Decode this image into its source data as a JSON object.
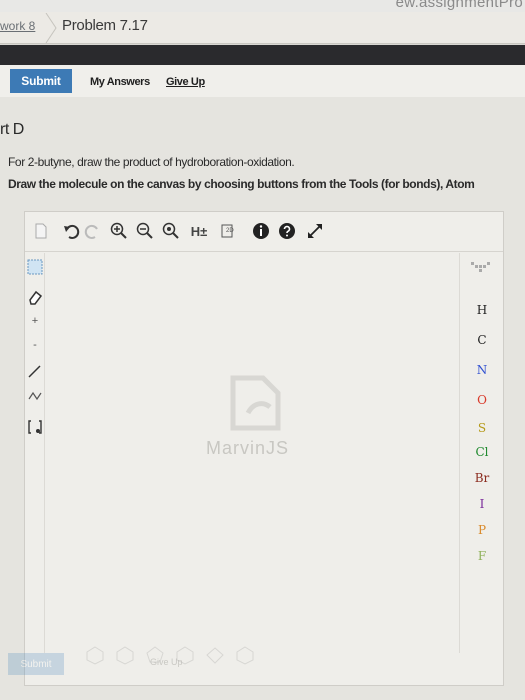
{
  "browser": {
    "url_fragment": "ew.assignmentPro"
  },
  "breadcrumb": {
    "previous": "work 8",
    "current": "Problem 7.17"
  },
  "actions": {
    "submit_label": "Submit",
    "my_answers_label": "My Answers",
    "give_up_label": "Give Up"
  },
  "question": {
    "part_title": "rt D",
    "line1": "For 2-butyne, draw the product of hydroboration-oxidation.",
    "line2": "Draw the molecule on the canvas by choosing buttons from the Tools (for bonds), Atom"
  },
  "editor": {
    "toolbar": {
      "h_toggle_label": "H±"
    },
    "atoms": [
      "H",
      "C",
      "N",
      "O",
      "S",
      "Cl",
      "Br",
      "I",
      "P",
      "F"
    ],
    "atom_colors": {
      "H": "#222222",
      "C": "#222222",
      "N": "#2f4fd0",
      "O": "#d93a2b",
      "S": "#b59a1a",
      "Cl": "#1f8a2e",
      "Br": "#8b2b1f",
      "I": "#7a2a9a",
      "P": "#d98a2b",
      "F": "#8fb15a"
    },
    "watermark": "MarvinJS",
    "ghost_submit_label": "Submit",
    "ghost_text": "Give Up"
  }
}
